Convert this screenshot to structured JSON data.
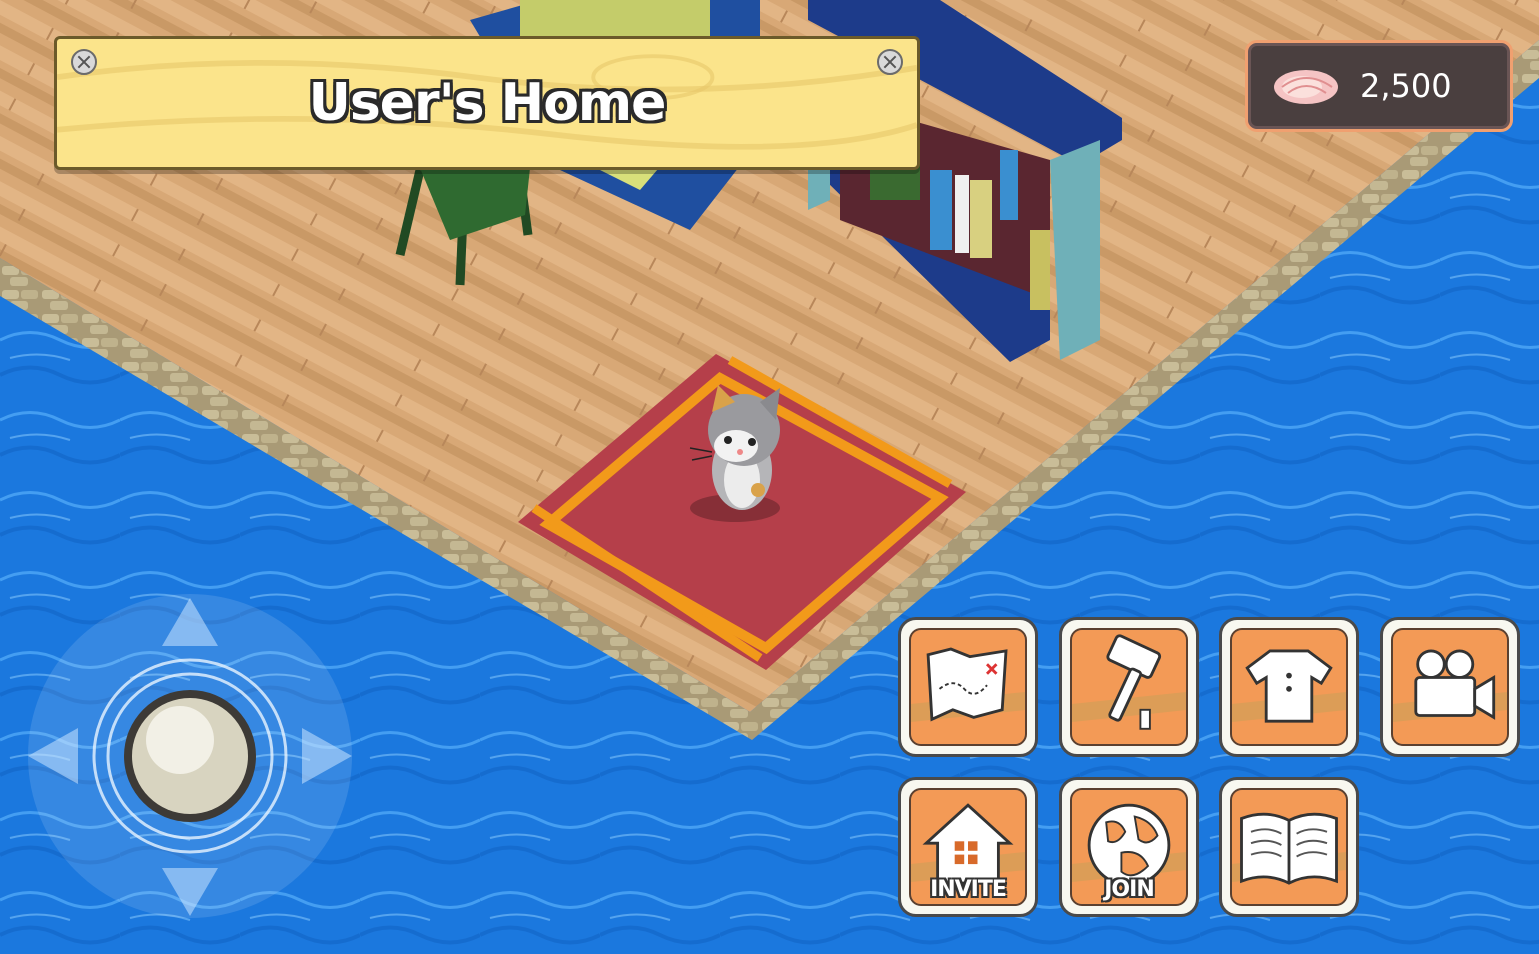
{
  "header": {
    "location_title": "User's Home"
  },
  "currency": {
    "icon": "seashell-icon",
    "amount": "2,500"
  },
  "action_buttons": [
    {
      "name": "map-button",
      "icon": "treasure-map-icon",
      "label": ""
    },
    {
      "name": "build-button",
      "icon": "hammer-icon",
      "label": ""
    },
    {
      "name": "clothes-button",
      "icon": "shirt-icon",
      "label": ""
    },
    {
      "name": "camera-button",
      "icon": "video-camera-icon",
      "label": ""
    },
    {
      "name": "invite-button",
      "icon": "house-icon",
      "label": "INVITE"
    },
    {
      "name": "join-button",
      "icon": "globe-icon",
      "label": "JOIN"
    },
    {
      "name": "book-button",
      "icon": "open-book-icon",
      "label": ""
    }
  ],
  "controls": {
    "joystick": "virtual-joystick",
    "directions": [
      "up-arrow-icon",
      "down-arrow-icon",
      "left-arrow-icon",
      "right-arrow-icon"
    ]
  },
  "colors": {
    "water": "#1f7fe0",
    "floor": "#d9ab7a",
    "rug": "#b53f4a",
    "rug_trim": "#f29a1a",
    "button_face": "#f39a56",
    "title_board": "#fbe48b"
  }
}
